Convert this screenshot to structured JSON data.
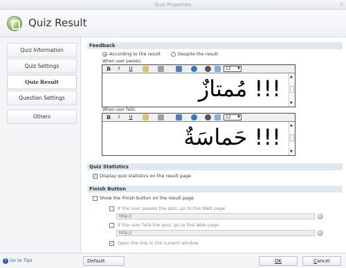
{
  "window": {
    "title": "Quiz Properties",
    "close": "×"
  },
  "header": {
    "title": "Quiz Result"
  },
  "sidebar": {
    "items": [
      {
        "label": "Quiz Information"
      },
      {
        "label": "Quiz Settings"
      },
      {
        "label": "Quiz Result",
        "active": true
      },
      {
        "label": "Question Settings"
      },
      {
        "label": "Others"
      }
    ]
  },
  "feedback": {
    "section_title": "Feedback",
    "radio_according": "According to the result",
    "radio_despite": "Despite the result",
    "selected": "According to the result",
    "pass_label": "When user passes:",
    "fail_label": "When user fails:",
    "pass_text": "!!! مُمتازٌ",
    "fail_text": "!!! حَماسَةٌ",
    "font_size": "12"
  },
  "toolbar": {
    "bold": "B",
    "italic": "I",
    "underline": "U"
  },
  "quiz_statistics": {
    "section_title": "Quiz Statistics",
    "display_label": "Display quiz statistics on the result page",
    "display_checked": true
  },
  "finish_button": {
    "section_title": "Finish Button",
    "show_label": "Show the Finish button on the result page",
    "show_checked": false,
    "pass_url_label": "If the user passes the quiz, go to this Web page",
    "pass_url": "http://",
    "fail_url_label": "If the user fails the quiz, go to this Web page",
    "fail_url": "http://",
    "open_current_label": "Open the link in the current window",
    "open_current_checked": true
  },
  "footer": {
    "tips": "Go to Tips",
    "default": "Default",
    "ok": "OK",
    "cancel": "Cancel"
  },
  "icons": [
    "gear-icon",
    "help-icon",
    "globe-icon",
    "image-icon",
    "table-icon",
    "flash-icon",
    "link-icon",
    "chevron-down-icon"
  ],
  "colors": {
    "section_bar": "#dfe8f1",
    "sidebar_bg": "#f3f5f7",
    "accent": "#2c5bb8"
  }
}
